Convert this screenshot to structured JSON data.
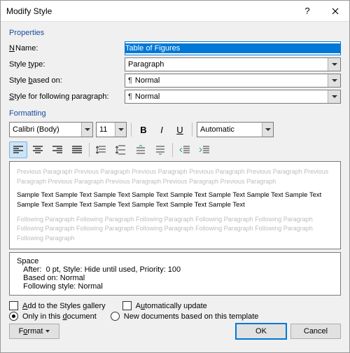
{
  "title": "Modify Style",
  "props_label": "Properties",
  "labels": {
    "name": "Name:",
    "styletype": "Style type:",
    "basedon": "Style based on:",
    "following": "Style for following paragraph:"
  },
  "name_value": "Table of Figures",
  "styletype_value": "Paragraph",
  "basedon_value": "Normal",
  "following_value": "Normal",
  "formatting_label": "Formatting",
  "font_name": "Calibri (Body)",
  "font_size": "11",
  "color_label": "Automatic",
  "preview_ghost": "Previous Paragraph Previous Paragraph Previous Paragraph Previous Paragraph Previous Paragraph Previous Paragraph Previous Paragraph Previous Paragraph Previous Paragraph Previous Paragraph",
  "preview_sample": "Sample Text Sample Text Sample Text Sample Text Sample Text Sample Text Sample Text Sample Text Sample Text Sample Text Sample Text Sample Text Sample Text Sample Text",
  "preview_follow": "Following Paragraph Following Paragraph Following Paragraph Following Paragraph Following Paragraph Following Paragraph Following Paragraph Following Paragraph Following Paragraph Following Paragraph Following Paragraph",
  "desc": {
    "l1": "Space",
    "l2": "   After:  0 pt, Style: Hide until used, Priority: 100",
    "l3": "   Based on: Normal",
    "l4": "   Following style: Normal"
  },
  "add_gallery": "Add to the Styles gallery",
  "auto_update": "Automatically update",
  "only_doc": "Only in this document",
  "new_docs": "New documents based on this template",
  "format_btn": "Format",
  "ok": "OK",
  "cancel": "Cancel"
}
